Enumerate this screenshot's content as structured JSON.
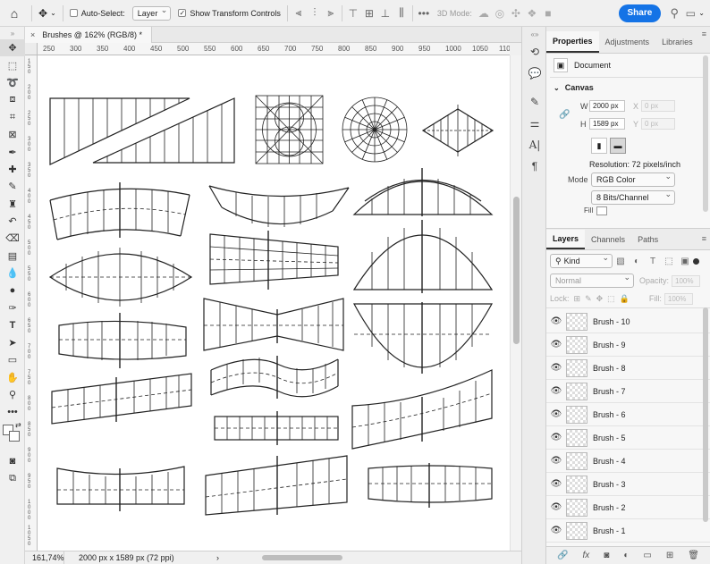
{
  "options_bar": {
    "auto_select_label": "Auto-Select:",
    "auto_select_target": "Layer",
    "show_transform_label": "Show Transform Controls",
    "more_label": "•••",
    "mode_3d_label": "3D Mode:",
    "share_label": "Share"
  },
  "document": {
    "tab_title": "Brushes @ 162% (RGB/8) *",
    "ruler_h": [
      "250",
      "300",
      "350",
      "400",
      "450",
      "500",
      "550",
      "600",
      "650",
      "700",
      "750",
      "800",
      "850",
      "900",
      "950",
      "1000",
      "1050",
      "110"
    ],
    "ruler_v": [
      "1\n5\n0",
      "2\n0\n0",
      "2\n5\n0",
      "3\n0\n0",
      "3\n5\n0",
      "4\n0\n0",
      "4\n5\n0",
      "5\n0\n0",
      "5\n5\n0",
      "6\n0\n0",
      "6\n5\n0",
      "7\n0\n0",
      "7\n5\n0",
      "8\n0\n0",
      "8\n5\n0",
      "9\n0\n0",
      "9\n5\n0",
      "1\n0\n0\n0",
      "1\n0\n5\n0"
    ]
  },
  "status": {
    "zoom": "161,74%",
    "doc_info": "2000 px x 1589 px (72 ppi)",
    "arrow": "›"
  },
  "properties": {
    "tabs": [
      "Properties",
      "Adjustments",
      "Libraries"
    ],
    "kind": "Document",
    "canvas_title": "Canvas",
    "w_label": "W",
    "w_value": "2000 px",
    "x_label": "X",
    "x_value": "0 px",
    "h_label": "H",
    "h_value": "1589 px",
    "y_label": "Y",
    "y_value": "0 px",
    "resolution": "Resolution: 72 pixels/inch",
    "mode_label": "Mode",
    "mode_value": "RGB Color",
    "bits_value": "8 Bits/Channel",
    "fill_label": "Fill"
  },
  "layers_panel": {
    "tabs": [
      "Layers",
      "Channels",
      "Paths"
    ],
    "kind_filter": "Kind",
    "blend_mode": "Normal",
    "opacity_label": "Opacity:",
    "opacity_value": "100%",
    "lock_label": "Lock:",
    "fill_label": "Fill:",
    "fill_value": "100%",
    "layers": [
      "Brush - 10",
      "Brush - 9",
      "Brush - 8",
      "Brush - 7",
      "Brush - 6",
      "Brush - 5",
      "Brush - 4",
      "Brush - 3",
      "Brush - 2",
      "Brush - 1"
    ]
  },
  "accent_color": "#1473e6"
}
